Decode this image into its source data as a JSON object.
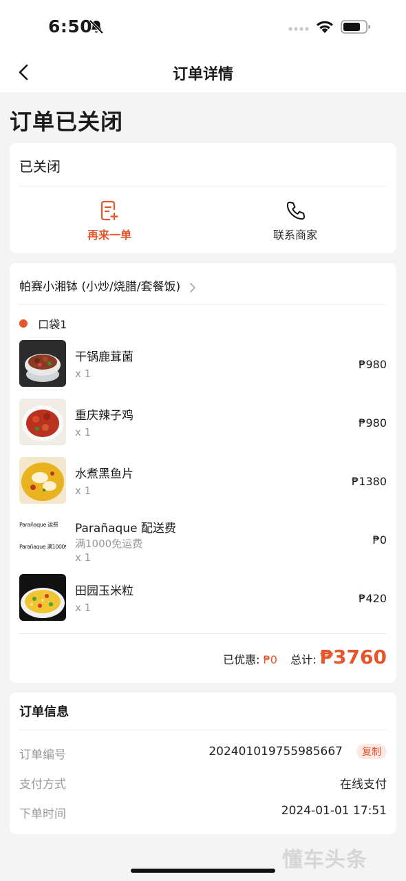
{
  "status_bar": {
    "time": "6:50"
  },
  "nav": {
    "title": "订单详情"
  },
  "page_title": "订单已关闭",
  "status_card": {
    "status": "已关闭",
    "reorder_label": "再来一单",
    "contact_label": "联系商家"
  },
  "shop": {
    "name": "帕赛小湘钵 (小炒/烧腊/套餐饭)"
  },
  "bag": {
    "label": "口袋1"
  },
  "items": [
    {
      "name": "干锅鹿茸菌",
      "qty": "x 1",
      "price": "₱980"
    },
    {
      "name": "重庆辣子鸡",
      "qty": "x 1",
      "price": "₱980"
    },
    {
      "name": "水煮黑鱼片",
      "qty": "x 1",
      "price": "₱1380"
    },
    {
      "name": "Parañaque 配送费",
      "sub": "满1000免运费",
      "qty": "x 1",
      "price": "₱0",
      "thumb_text_1": "Parañaque 运费",
      "thumb_text_2": "Parañaque 满1000免运费"
    },
    {
      "name": "田园玉米粒",
      "qty": "x 1",
      "price": "₱420"
    }
  ],
  "summary": {
    "discount_label": "已优惠:",
    "discount_value": "₱0",
    "total_label": "总计:",
    "total_value": "₱3760"
  },
  "order_info": {
    "title": "订单信息",
    "order_no_label": "订单编号",
    "order_no": "202401019755985667",
    "copy_label": "复制",
    "payment_label": "支付方式",
    "payment": "在线支付",
    "time_label": "下单时间",
    "time": "2024-01-01 17:51"
  },
  "watermark": "懂车头条",
  "colors": {
    "accent": "#e8542a",
    "muted": "#999999",
    "background": "#f4f4f4"
  },
  "icons": [
    "bell-slash-icon",
    "signal-dots-icon",
    "wifi-icon",
    "battery-icon",
    "back-arrow-icon",
    "reorder-icon",
    "phone-icon",
    "chevron-right-icon"
  ]
}
